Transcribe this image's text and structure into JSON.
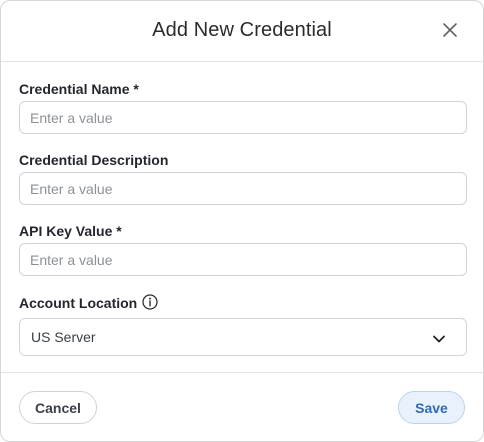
{
  "dialog": {
    "title": "Add New Credential",
    "close_icon": "close-icon"
  },
  "fields": {
    "name": {
      "label": "Credential Name *",
      "placeholder": "Enter a value",
      "value": ""
    },
    "description": {
      "label": "Credential Description",
      "placeholder": "Enter a value",
      "value": ""
    },
    "api_key": {
      "label": "API Key Value *",
      "placeholder": "Enter a value",
      "value": ""
    },
    "account_location": {
      "label": "Account Location",
      "info_icon": "info-icon",
      "selected": "US Server",
      "chevron_icon": "chevron-down-icon"
    }
  },
  "footer": {
    "cancel_label": "Cancel",
    "save_label": "Save"
  },
  "colors": {
    "save_bg": "#e9f2fc",
    "save_text": "#2f6bb3",
    "border": "#cfd3d7"
  }
}
